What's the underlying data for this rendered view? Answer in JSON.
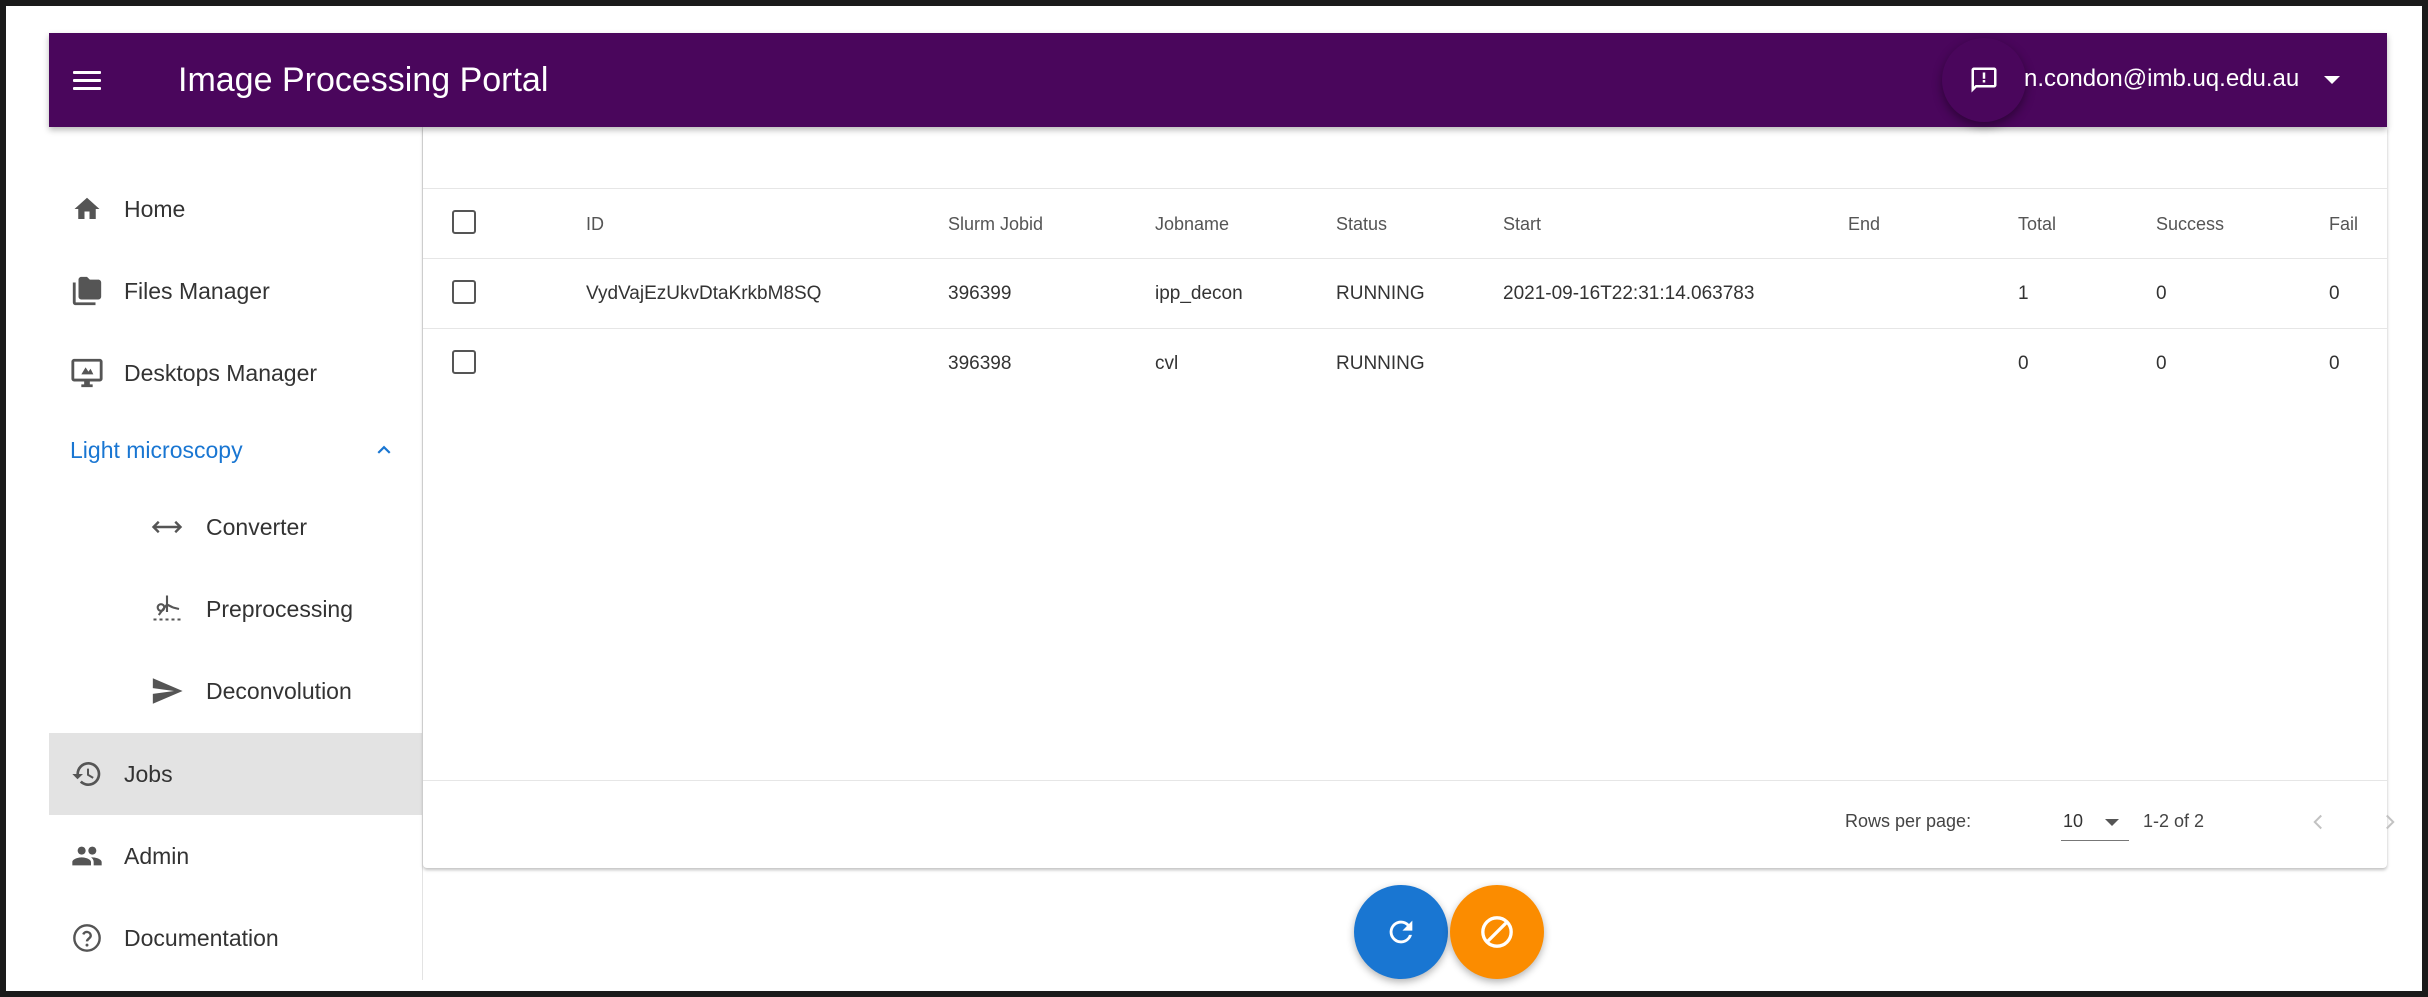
{
  "header": {
    "title": "Image Processing Portal",
    "menu_icon": "menu-icon",
    "feedback_icon": "feedback-icon",
    "user_email": "n.condon@imb.uq.edu.au",
    "user_menu_icon": "arrow-drop-down-icon",
    "color": "#4a065c"
  },
  "sidebar": {
    "items": [
      {
        "label": "Home",
        "icon": "home-icon"
      },
      {
        "label": "Files Manager",
        "icon": "folder-icon"
      },
      {
        "label": "Desktops Manager",
        "icon": "desktop-icon"
      }
    ],
    "group": {
      "label": "Light microscopy",
      "expanded": true,
      "icon": "chevron-up-icon",
      "items": [
        {
          "label": "Converter",
          "icon": "swap-horiz-icon"
        },
        {
          "label": "Preprocessing",
          "icon": "preprocessing-icon"
        },
        {
          "label": "Deconvolution",
          "icon": "send-icon"
        }
      ]
    },
    "bottom_items": [
      {
        "label": "Jobs",
        "icon": "history-icon",
        "active": true
      },
      {
        "label": "Admin",
        "icon": "people-icon"
      },
      {
        "label": "Documentation",
        "icon": "help-outline-icon"
      }
    ],
    "active_color": "#e3e3e3",
    "group_color": "#1976d2"
  },
  "jobs_table": {
    "columns": [
      "ID",
      "Slurm Jobid",
      "Jobname",
      "Status",
      "Start",
      "End",
      "Total",
      "Success",
      "Fail"
    ],
    "rows": [
      {
        "id": "VydVajEzUkvDtaKrkbM8SQ",
        "slurm_jobid": "396399",
        "jobname": "ipp_decon",
        "status": "RUNNING",
        "start": "2021-09-16T22:31:14.063783",
        "end": "",
        "total": "1",
        "success": "0",
        "fail": "0"
      },
      {
        "id": "",
        "slurm_jobid": "396398",
        "jobname": "cvl",
        "status": "RUNNING",
        "start": "",
        "end": "",
        "total": "0",
        "success": "0",
        "fail": "0"
      }
    ],
    "pagination": {
      "rows_per_page_label": "Rows per page:",
      "rows_per_page": "10",
      "range": "1-2 of 2",
      "prev_icon": "chevron-left-icon",
      "next_icon": "chevron-right-icon"
    }
  },
  "actions": {
    "refresh_icon": "refresh-icon",
    "refresh_color": "#1976d2",
    "cancel_icon": "block-icon",
    "cancel_color": "#fb8c00"
  }
}
